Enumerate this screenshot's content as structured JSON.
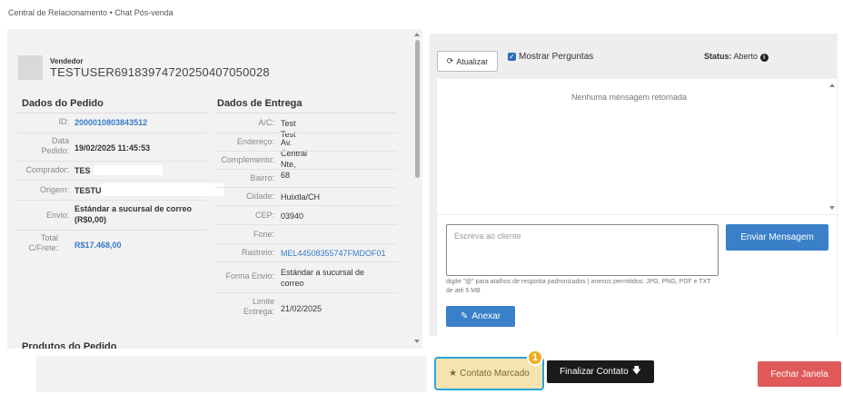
{
  "breadcrumb": "Central de Relacionamento • Chat Pós-venda",
  "seller": {
    "label": "Vendedor",
    "name": "TESTUSER6918397472025040705002​8"
  },
  "order": {
    "title": "Dados do Pedido",
    "rows": [
      {
        "label": "ID:",
        "value": "2000010803843512"
      },
      {
        "label": "Data Pedido:",
        "value": "19/02/2025 11:45:53"
      },
      {
        "label": "Comprador:",
        "value": "TES"
      },
      {
        "label": "Origem:",
        "value": "TESTU"
      },
      {
        "label": "Envio:",
        "value": "Estándar a sucursal de correo (R$0,00)"
      },
      {
        "label": "Total C/Frete:",
        "value": "R$17.468,00"
      }
    ]
  },
  "delivery": {
    "title": "Dados de Entrega",
    "rows": [
      {
        "label": "A/C:",
        "value": "Test Test"
      },
      {
        "label": "Endereço:",
        "value": "Av. Central Nte, 68"
      },
      {
        "label": "Complemento:",
        "value": ""
      },
      {
        "label": "Bairro:",
        "value": ""
      },
      {
        "label": "Cidade:",
        "value": "Huixtla/CH"
      },
      {
        "label": "CEP:",
        "value": "03940"
      },
      {
        "label": "Fone:",
        "value": ""
      },
      {
        "label": "Rastreio:",
        "value": "MEL44508355747FMDOF01"
      },
      {
        "label": "Forma Envio:",
        "value": "Estándar a sucursal de correo"
      },
      {
        "label": "Limite Entrega:",
        "value": "21/02/2025"
      }
    ]
  },
  "products_title": "Produtos do Pedido",
  "chat": {
    "refresh_label": "Atualizar",
    "show_questions_label": "Mostrar Perguntas",
    "status_label": "Status:",
    "status_value": "Aberto",
    "empty_message": "Nenhuma mensagem retornada",
    "reply_placeholder": "Escreva ao cliente",
    "send_label": "Enviar Mensagem",
    "hint": "digite \"@\" para atalhos de resposta padronizados | anexos permitidos: JPG, PNG, PDF e TXT de até 5 MB",
    "attach_label": "Anexar"
  },
  "footer": {
    "marked_label": "Contato Marcado",
    "badge": "1",
    "finish_label": "Finalizar Contato",
    "close_label": "Fechar Janela"
  },
  "colors": {
    "primary": "#3a80c9",
    "danger": "#e05a5a",
    "marked_bg": "#f6e3b0",
    "highlight_border": "#2aa3d8",
    "badge": "#f0ad20"
  }
}
